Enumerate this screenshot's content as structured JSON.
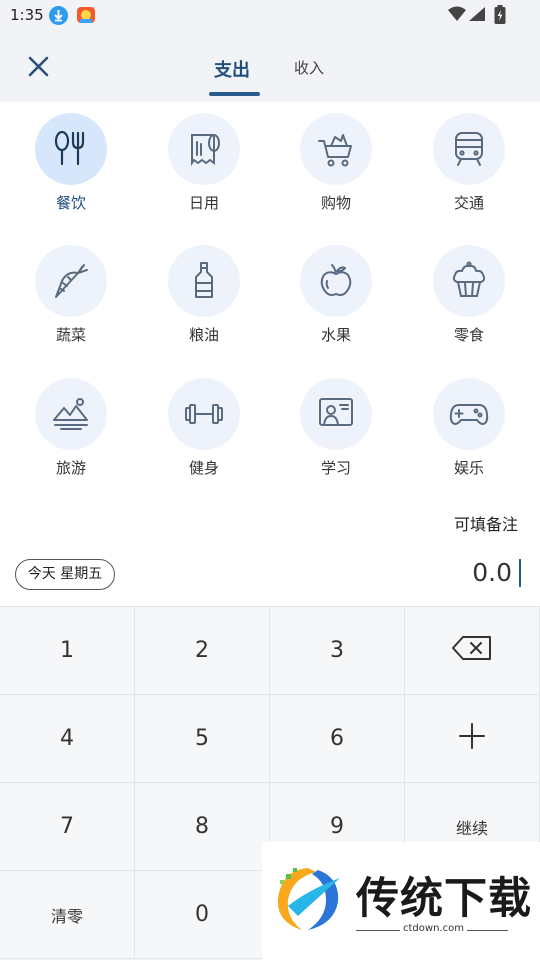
{
  "status_bar": {
    "time": "1:35"
  },
  "header": {
    "tabs": [
      "支出",
      "收入"
    ],
    "active_tab": "支出"
  },
  "categories": [
    {
      "label": "餐饮",
      "icon": "cutlery-icon",
      "active": true
    },
    {
      "label": "日用",
      "icon": "toilet-paper-icon",
      "active": false
    },
    {
      "label": "购物",
      "icon": "shopping-cart-icon",
      "active": false
    },
    {
      "label": "交通",
      "icon": "train-icon",
      "active": false
    },
    {
      "label": "蔬菜",
      "icon": "carrot-icon",
      "active": false
    },
    {
      "label": "粮油",
      "icon": "oil-bottle-icon",
      "active": false
    },
    {
      "label": "水果",
      "icon": "apple-icon",
      "active": false
    },
    {
      "label": "零食",
      "icon": "cupcake-icon",
      "active": false
    },
    {
      "label": "旅游",
      "icon": "mountain-picture-icon",
      "active": false
    },
    {
      "label": "健身",
      "icon": "dumbbell-icon",
      "active": false
    },
    {
      "label": "学习",
      "icon": "teacher-board-icon",
      "active": false
    },
    {
      "label": "娱乐",
      "icon": "gamepad-icon",
      "active": false
    }
  ],
  "note_placeholder": "可填备注",
  "date_chip": "今天 星期五",
  "amount": "0.0",
  "keypad": {
    "rows": [
      [
        "1",
        "2",
        "3",
        "⌫"
      ],
      [
        "4",
        "5",
        "6",
        "+"
      ],
      [
        "7",
        "8",
        "9",
        "继续"
      ],
      [
        "清零",
        "0",
        "",
        ""
      ]
    ]
  },
  "watermark": {
    "title": "传统下载",
    "url": "ctdown.com"
  }
}
